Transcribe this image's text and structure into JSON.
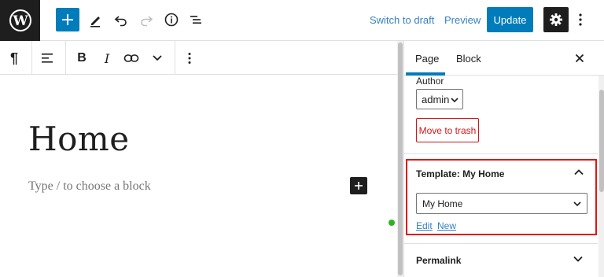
{
  "header": {
    "logo": "wordpress-icon",
    "icons": {
      "add": "plus-icon",
      "tools": "pencil-icon",
      "undo": "undo-icon",
      "redo": "redo-icon",
      "details": "info-icon",
      "outline": "list-view-icon",
      "settings": "gear-icon",
      "more": "more-vertical-icon"
    },
    "switch_to_draft": "Switch to draft",
    "preview": "Preview",
    "update": "Update"
  },
  "block_toolbar": {
    "paragraph_glyph": "¶",
    "bold": "B",
    "italic": "I"
  },
  "editor": {
    "title": "Home",
    "placeholder": "Type / to choose a block"
  },
  "sidebar": {
    "tabs": [
      {
        "label": "Page",
        "active": true
      },
      {
        "label": "Block",
        "active": false
      }
    ],
    "author": {
      "label": "Author",
      "value": "admin"
    },
    "move_to_trash": "Move to trash",
    "template": {
      "title": "Template: My Home",
      "selected": "My Home",
      "edit_link": "Edit",
      "new_link": "New"
    },
    "permalink": {
      "title": "Permalink"
    }
  },
  "colors": {
    "accent": "#007cba",
    "dark": "#1e1e1e",
    "danger": "#cc1818",
    "highlight": "#e01616",
    "status": "#2fb41f"
  }
}
